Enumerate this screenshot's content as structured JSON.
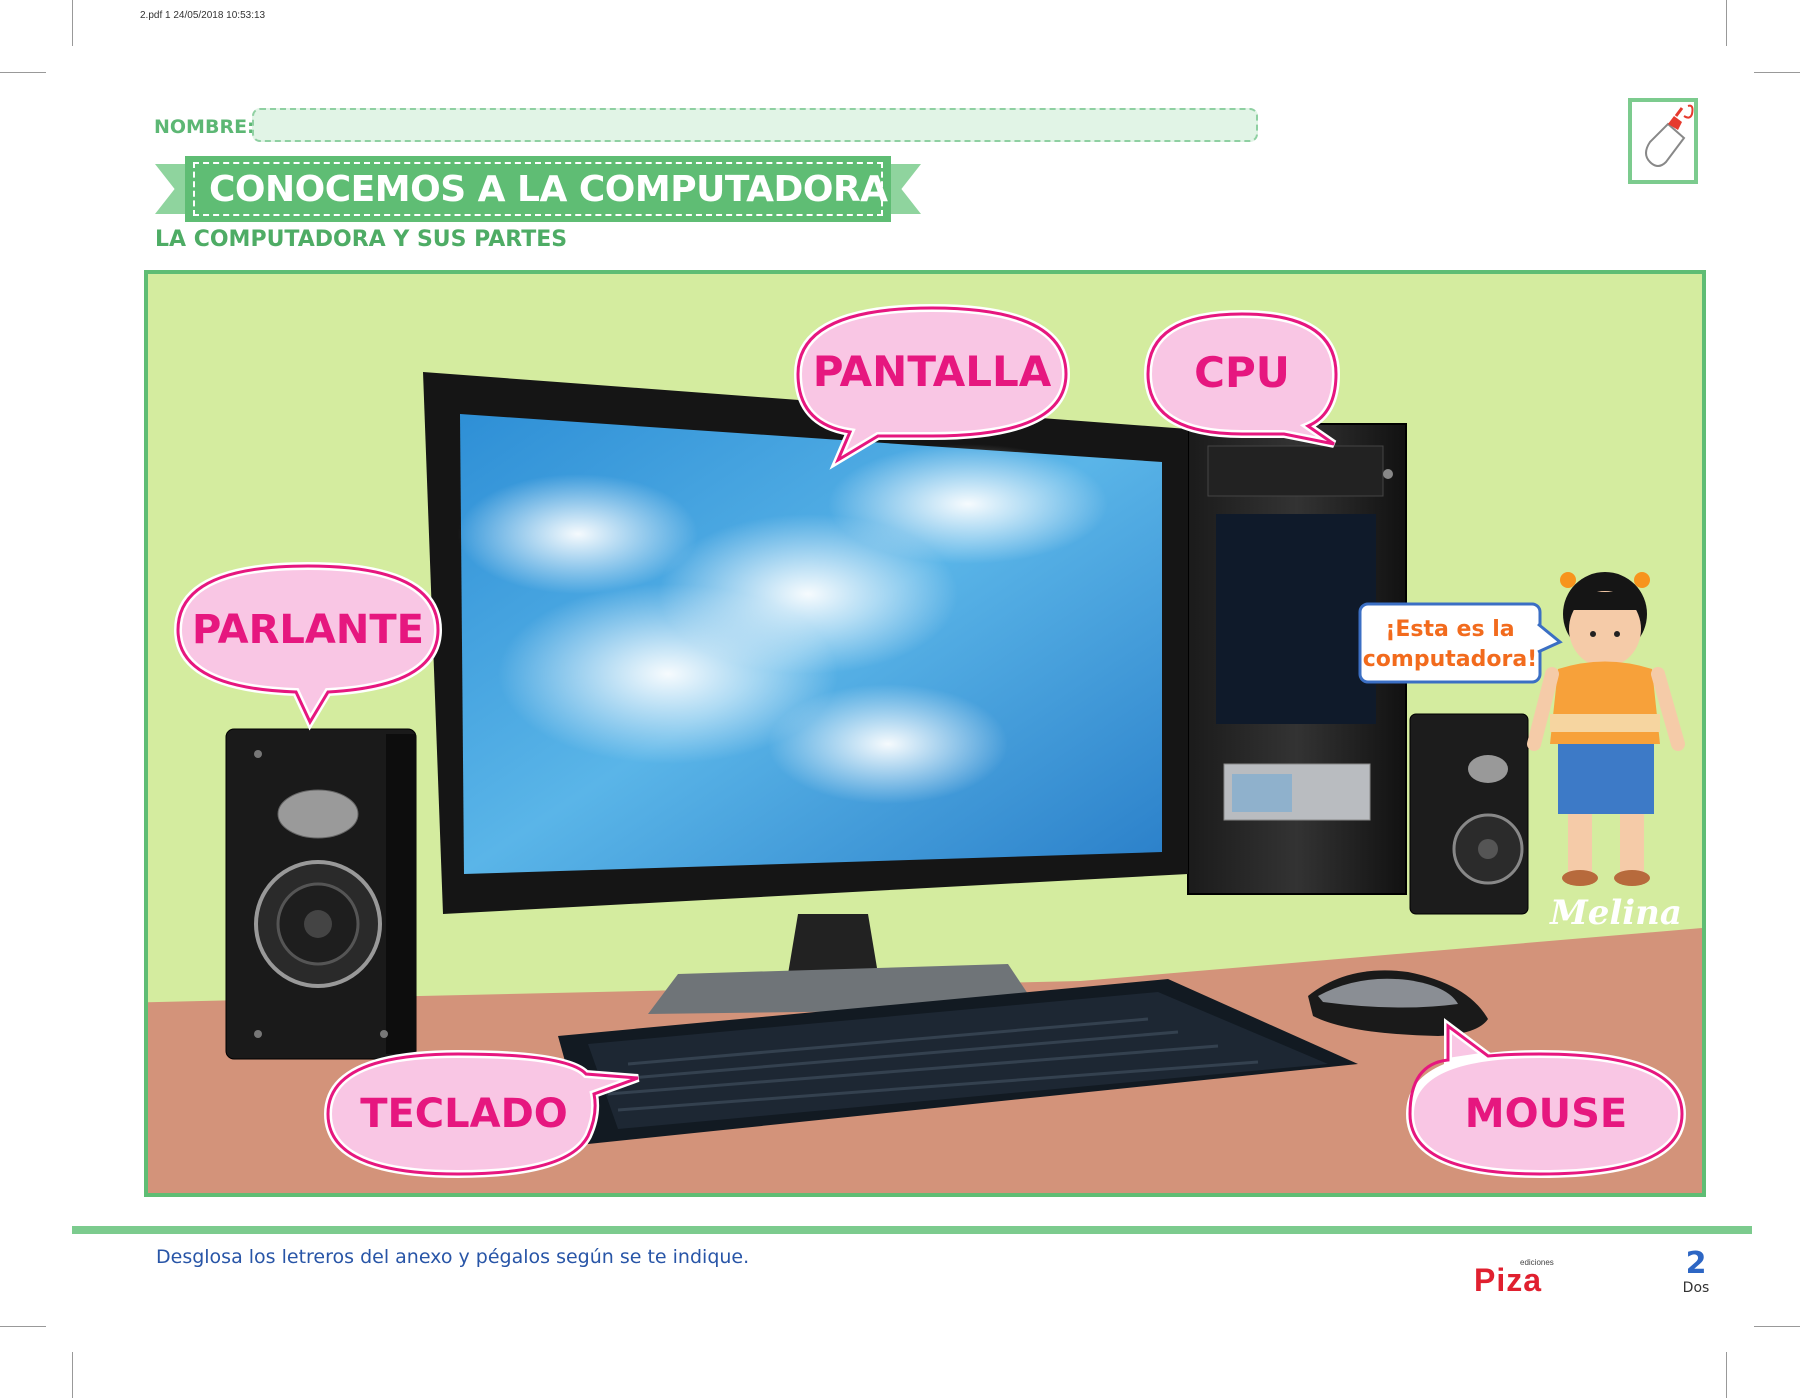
{
  "print_header": "2.pdf   1   24/05/2018   10:53:13",
  "worksheet": {
    "name_label": "NOMBRE:",
    "title": "CONOCEMOS A LA COMPUTADORA",
    "subtitle": "LA COMPUTADORA Y SUS PARTES"
  },
  "labels": {
    "pantalla": "PANTALLA",
    "cpu": "CPU",
    "parlante": "PARLANTE",
    "teclado": "TECLADO",
    "mouse": "MOUSE"
  },
  "character": {
    "speech_line1": "¡Esta es la",
    "speech_line2": "computadora!",
    "name": "Melina"
  },
  "footer": {
    "instruction": "Desglosa los letreros del anexo y pégalos según se te indique.",
    "publisher_small": "ediciones",
    "publisher_brand": "Piza",
    "page_number": "2",
    "page_word": "Dos"
  },
  "colors": {
    "accent_green": "#5fbd74",
    "wall": "#d4ec9f",
    "floor": "#d3937a",
    "label_pink": "#e6177f",
    "bubble_fill": "#f9c6e4",
    "footer_blue": "#2855a7"
  },
  "icons": {
    "glue": "glue-bottle-icon"
  }
}
